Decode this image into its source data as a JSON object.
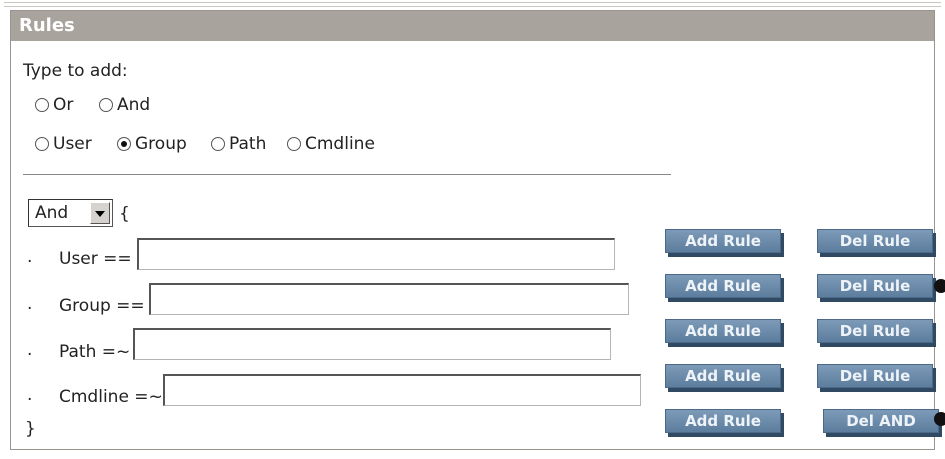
{
  "panel": {
    "title": "Rules",
    "type_to_add": "Type to add:",
    "logic_options": [
      "Or",
      "And"
    ],
    "field_options": [
      "User",
      "Group",
      "Path",
      "Cmdline"
    ],
    "selected_field": "Group"
  },
  "rule_group": {
    "operator": "And",
    "open_brace": "{",
    "close_brace": "}",
    "rules": [
      {
        "bullet": ".",
        "label": "User ==",
        "value": ""
      },
      {
        "bullet": ".",
        "label": "Group ==",
        "value": ""
      },
      {
        "bullet": ".",
        "label": "Path =~",
        "value": ""
      },
      {
        "bullet": ".",
        "label": "Cmdline =~",
        "value": ""
      }
    ]
  },
  "buttons": {
    "add_rule": "Add Rule",
    "del_rule": "Del Rule",
    "del_and": "Del AND"
  },
  "colors": {
    "titlebar": "#a8a39d",
    "button": "#6a89a8"
  }
}
